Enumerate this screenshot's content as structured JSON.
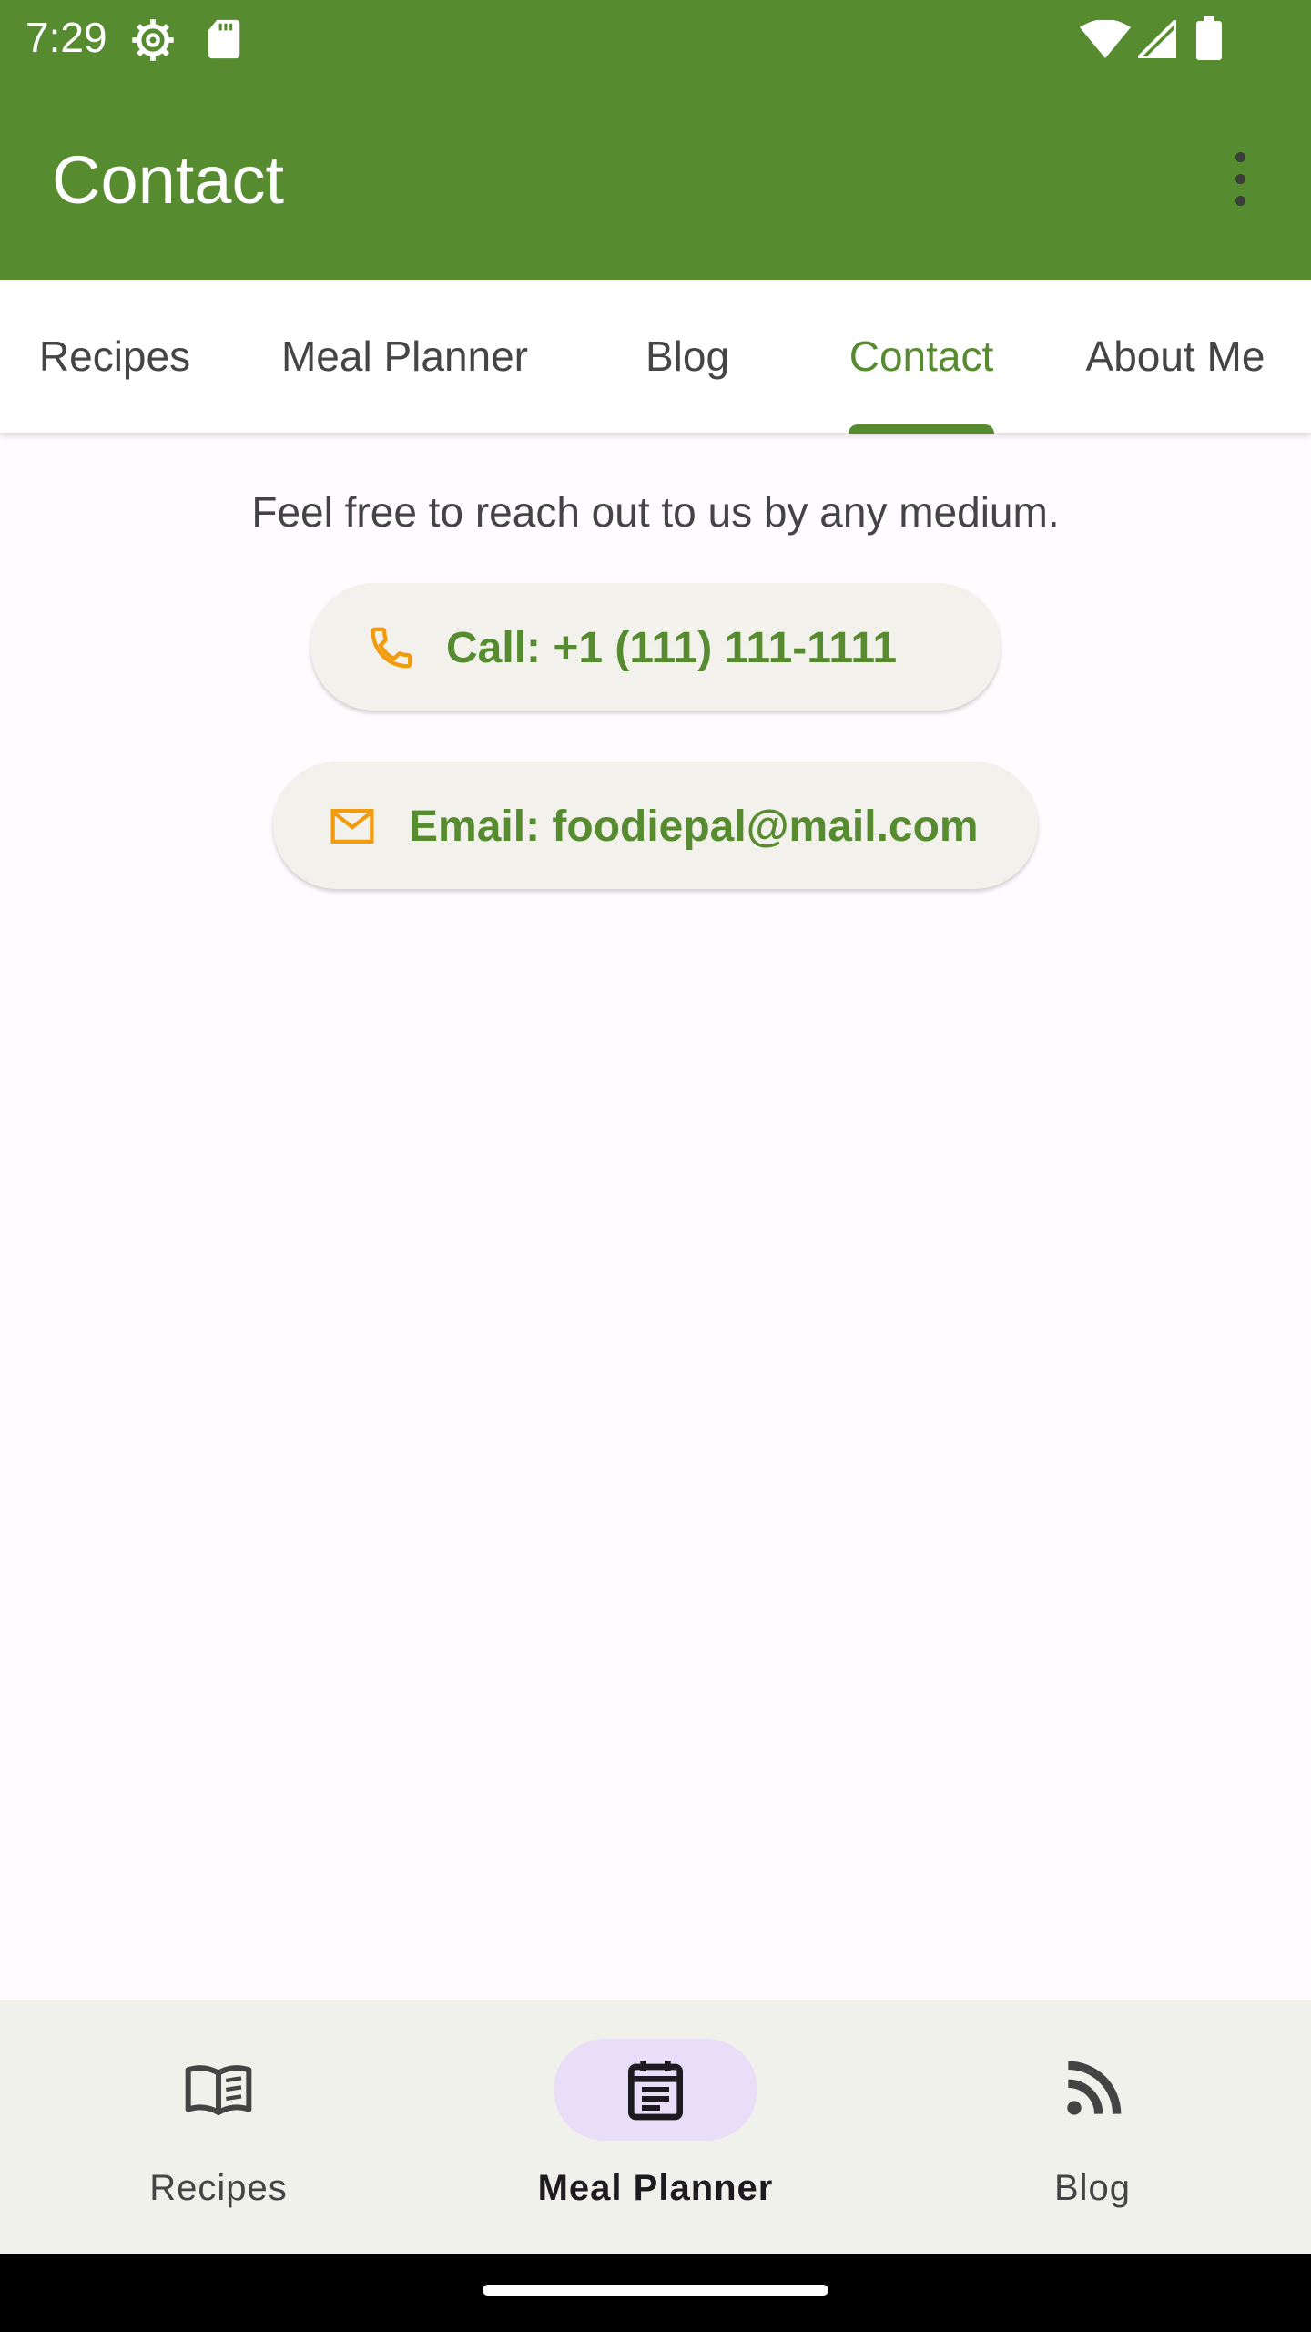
{
  "status_bar": {
    "time": "7:29",
    "left_icons": [
      "settings-gear-icon",
      "sd-card-icon"
    ],
    "right_icons": [
      "wifi-icon",
      "cell-signal-icon",
      "battery-icon"
    ]
  },
  "app_bar": {
    "title": "Contact",
    "overflow_icon": "more-vert-icon",
    "background_color": "#568c2f"
  },
  "tabs": [
    {
      "label": "Recipes",
      "active": false
    },
    {
      "label": "Meal Planner",
      "active": false
    },
    {
      "label": "Blog",
      "active": false
    },
    {
      "label": "Contact",
      "active": true
    },
    {
      "label": "About Me",
      "active": false
    }
  ],
  "content": {
    "intro": "Feel free to reach out to us by any medium.",
    "call": {
      "label": "Call: +1 (111) 111-1111",
      "icon": "phone-icon"
    },
    "email": {
      "label": "Email: foodiepal@mail.com",
      "icon": "mail-icon"
    },
    "accent_color": "#568c2f",
    "icon_color": "#f29b0c"
  },
  "bottom_nav": [
    {
      "label": "Recipes",
      "icon": "book-icon",
      "active": false
    },
    {
      "label": "Meal Planner",
      "icon": "planner-icon",
      "active": true
    },
    {
      "label": "Blog",
      "icon": "rss-feed-icon",
      "active": false
    }
  ]
}
